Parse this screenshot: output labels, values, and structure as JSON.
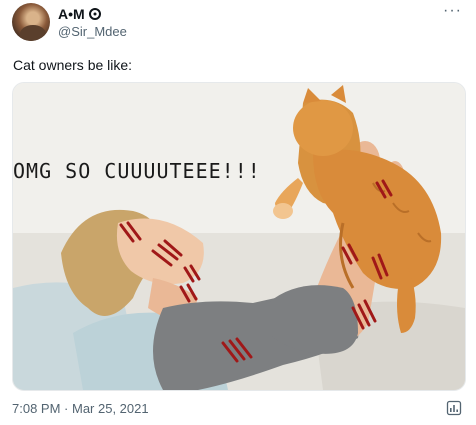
{
  "author": {
    "display_name": "A•M",
    "handle": "@Sir_Mdee"
  },
  "tweet": {
    "text": "Cat owners be like:",
    "meme_caption": "OMG SO CUUUUTEEE!!!",
    "time": "7:08 PM",
    "separator": " · ",
    "date": "Mar 25, 2021"
  },
  "icons": {
    "more": "more-dots-icon",
    "verified": "verified-badge-icon",
    "analytics": "view-analytics-icon"
  },
  "colors": {
    "text_primary": "#0f1419",
    "text_secondary": "#536471",
    "cat_orange": "#d98b3a",
    "scratch_red": "#a01818"
  }
}
